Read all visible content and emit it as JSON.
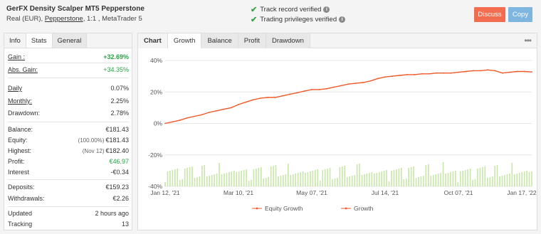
{
  "header": {
    "title": "GerFX Density Scalper MT5 Pepperstone",
    "subtitle_prefix": "Real (EUR),",
    "broker": "Pepperstone",
    "subtitle_suffix": ", 1:1 , MetaTrader 5",
    "verified_1": "Track record verified",
    "verified_2": "Trading privileges verified",
    "discuss_label": "Discuss",
    "copy_label": "Copy"
  },
  "left_tabs": [
    "Info",
    "Stats",
    "General"
  ],
  "stats": {
    "gain_label": "Gain :",
    "gain_value": "+32.69%",
    "abs_gain_label": "Abs. Gain:",
    "abs_gain_value": "+34.35%",
    "daily_label": "Daily",
    "daily_value": "0.07%",
    "monthly_label": "Monthly:",
    "monthly_value": "2.25%",
    "drawdown_label": "Drawdown:",
    "drawdown_value": "2.78%",
    "balance_label": "Balance:",
    "balance_value": "€181.43",
    "equity_label": "Equity:",
    "equity_sub": "(100.00%)",
    "equity_value": "€181.43",
    "highest_label": "Highest:",
    "highest_sub": "(Nov 12)",
    "highest_value": "€182.40",
    "profit_label": "Profit:",
    "profit_value": "€46.97",
    "interest_label": "Interest",
    "interest_value": "-€0.34",
    "deposits_label": "Deposits:",
    "deposits_value": "€159.23",
    "withdrawals_label": "Withdrawals:",
    "withdrawals_value": "€2.26",
    "updated_label": "Updated",
    "updated_value": "2 hours ago",
    "tracking_label": "Tracking",
    "tracking_value": "13"
  },
  "chart_tabs": {
    "label": "Chart",
    "items": [
      "Growth",
      "Balance",
      "Profit",
      "Drawdown"
    ],
    "active": "Growth"
  },
  "chart_data": {
    "type": "line",
    "x_tick_labels": [
      "Jan 12, '21",
      "Mar 10, '21",
      "May 07, '21",
      "Jul 14, '21",
      "Oct 07, '21",
      "Jan 17, '22"
    ],
    "y_tick_labels": [
      "40%",
      "20%",
      "0%",
      "-20%",
      "-40%"
    ],
    "ylim": [
      -40,
      40
    ],
    "legend": [
      "Equity Growth",
      "Growth"
    ],
    "colors": {
      "growth": "#f05a28",
      "bars": "#c8e6a8",
      "grid": "#e6e6e6"
    },
    "series": [
      {
        "name": "Growth",
        "points": [
          [
            0,
            0
          ],
          [
            0.02,
            1
          ],
          [
            0.04,
            2
          ],
          [
            0.06,
            3.5
          ],
          [
            0.08,
            4.5
          ],
          [
            0.1,
            5.5
          ],
          [
            0.12,
            7
          ],
          [
            0.14,
            8
          ],
          [
            0.16,
            9
          ],
          [
            0.18,
            10
          ],
          [
            0.2,
            12
          ],
          [
            0.22,
            13.5
          ],
          [
            0.24,
            15
          ],
          [
            0.26,
            16
          ],
          [
            0.28,
            16.5
          ],
          [
            0.3,
            16.5
          ],
          [
            0.32,
            17.5
          ],
          [
            0.34,
            18.5
          ],
          [
            0.36,
            19.5
          ],
          [
            0.38,
            20.5
          ],
          [
            0.4,
            21.5
          ],
          [
            0.42,
            21.5
          ],
          [
            0.44,
            22
          ],
          [
            0.46,
            23
          ],
          [
            0.48,
            24
          ],
          [
            0.5,
            25
          ],
          [
            0.52,
            25.5
          ],
          [
            0.54,
            26
          ],
          [
            0.56,
            27
          ],
          [
            0.58,
            28.5
          ],
          [
            0.6,
            29.5
          ],
          [
            0.62,
            30
          ],
          [
            0.64,
            30.5
          ],
          [
            0.66,
            31
          ],
          [
            0.68,
            31
          ],
          [
            0.7,
            31.5
          ],
          [
            0.72,
            31.5
          ],
          [
            0.74,
            32
          ],
          [
            0.76,
            32
          ],
          [
            0.78,
            32
          ],
          [
            0.8,
            32.5
          ],
          [
            0.82,
            33
          ],
          [
            0.84,
            33.5
          ],
          [
            0.86,
            33.5
          ],
          [
            0.88,
            34
          ],
          [
            0.9,
            33.5
          ],
          [
            0.92,
            32
          ],
          [
            0.94,
            32.5
          ],
          [
            0.96,
            33
          ],
          [
            0.98,
            33
          ],
          [
            1.0,
            32.7
          ]
        ]
      }
    ]
  }
}
